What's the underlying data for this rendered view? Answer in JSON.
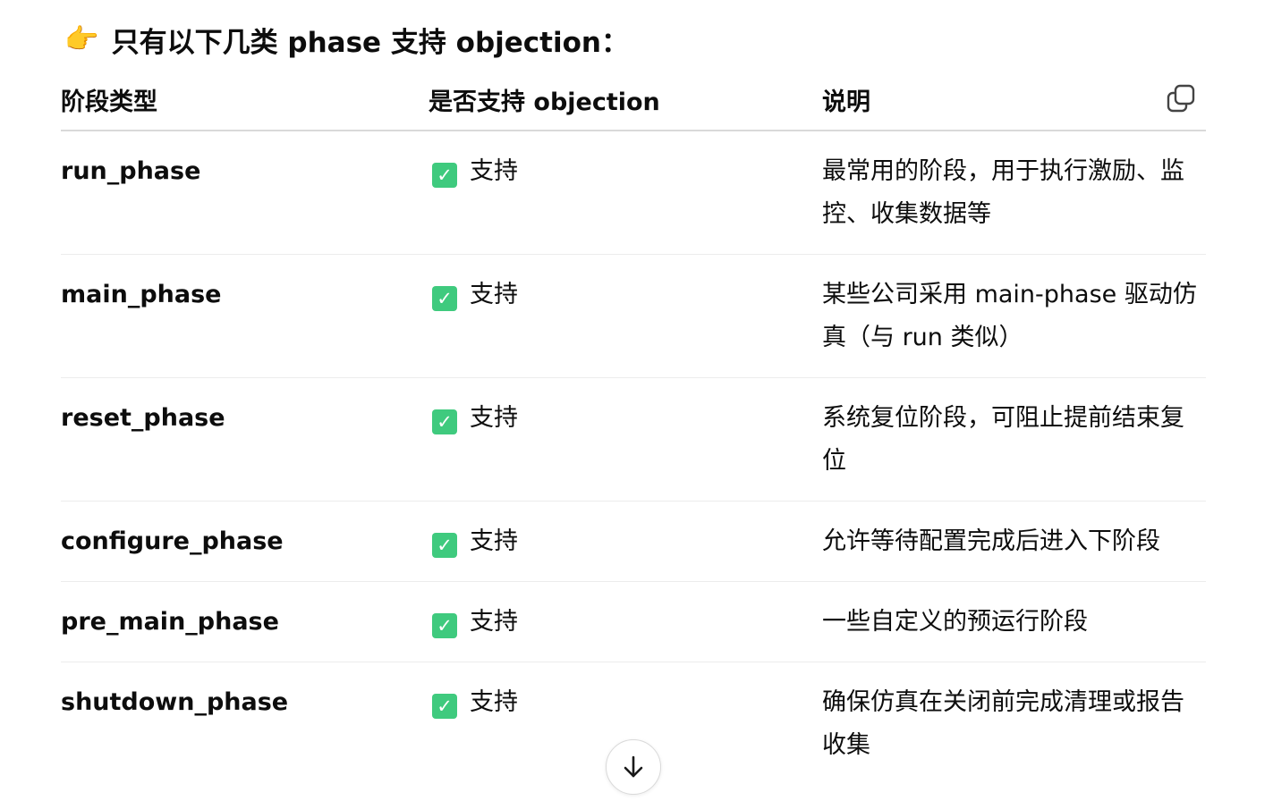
{
  "heading": {
    "icon": "pointing-right-hand",
    "emoji": "👉",
    "text": "只有以下几类 phase 支持 objection："
  },
  "table": {
    "headers": [
      "阶段类型",
      "是否支持 objection",
      "说明"
    ],
    "rows": [
      {
        "phase": "run_phase",
        "support": "支持",
        "desc": "最常用的阶段，用于执行激励、监控、收集数据等"
      },
      {
        "phase": "main_phase",
        "support": "支持",
        "desc": "某些公司采用 main-phase 驱动仿真（与 run 类似）"
      },
      {
        "phase": "reset_phase",
        "support": "支持",
        "desc": "系统复位阶段，可阻止提前结束复位"
      },
      {
        "phase": "configure_phase",
        "support": "支持",
        "desc": "允许等待配置完成后进入下阶段"
      },
      {
        "phase": "pre_main_phase",
        "support": "支持",
        "desc": "一些自定义的预运行阶段"
      },
      {
        "phase": "shutdown_phase",
        "support": "支持",
        "desc": "确保仿真在关闭前完成清理或报告收集"
      }
    ]
  },
  "icons": {
    "check": "check-mark-box",
    "copy": "copy-icon",
    "scroll": "arrow-down-icon"
  },
  "colors": {
    "check_green": "#3fca7e",
    "text": "#0d0d0d",
    "divider": "#ececec"
  }
}
